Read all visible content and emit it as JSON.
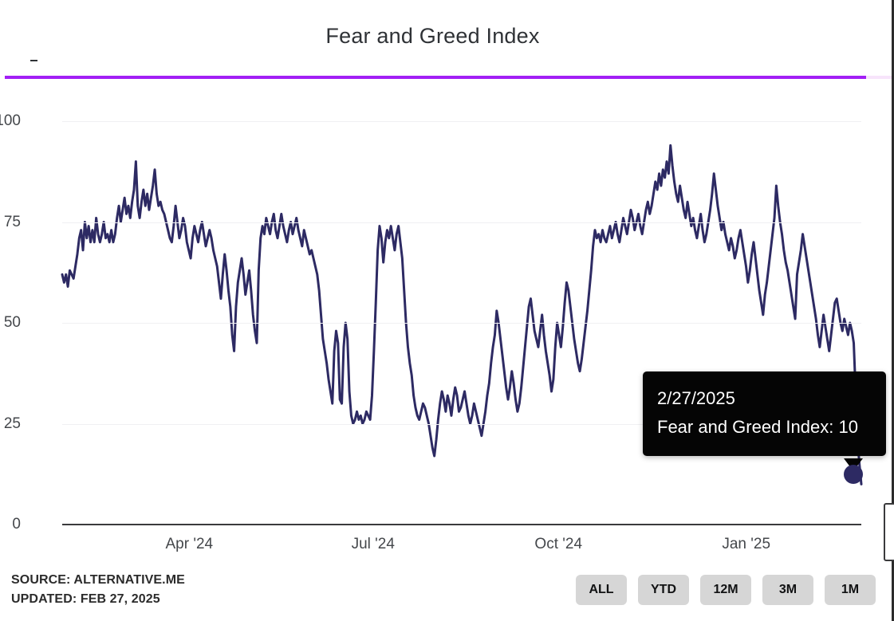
{
  "header": {
    "title": "Fear and Greed Index"
  },
  "progress": {
    "percent": 97,
    "fill_color": "#a21ff5",
    "track_color": "#f7e4fb"
  },
  "tooltip": {
    "date": "2/27/2025",
    "value_line": "Fear and Greed Index: 10",
    "background": "#050505",
    "text_color": "#ffffff"
  },
  "marker": {
    "color": "#2d2a63",
    "value": 10,
    "date": "2/27/2025"
  },
  "footer": {
    "source": "SOURCE: ALTERNATIVE.ME",
    "updated": "UPDATED: FEB 27, 2025"
  },
  "range_buttons": [
    {
      "label": "ALL",
      "selected": false
    },
    {
      "label": "YTD",
      "selected": false
    },
    {
      "label": "12M",
      "selected": false
    },
    {
      "label": "3M",
      "selected": false
    },
    {
      "label": "1M",
      "selected": false
    }
  ],
  "chart_data": {
    "type": "line",
    "title": "Fear and Greed Index",
    "xlabel": "",
    "ylabel": "",
    "ylim": [
      0,
      100
    ],
    "yticks": [
      0,
      25,
      50,
      75,
      100
    ],
    "xticks": [
      "Apr '24",
      "Jul '24",
      "Oct '24",
      "Jan '25"
    ],
    "xtick_positions": [
      0.159,
      0.389,
      0.621,
      0.856
    ],
    "grid": true,
    "legend": false,
    "line_color": "#2d2a63",
    "line_width": 3,
    "x_start": "2024-03-01",
    "x_end": "2025-02-27",
    "series": [
      {
        "name": "Fear and Greed Index",
        "values": [
          62,
          60,
          62,
          59,
          63,
          62,
          61,
          64,
          67,
          71,
          73,
          68,
          75,
          71,
          74,
          70,
          73,
          70,
          76,
          72,
          70,
          72,
          75,
          71,
          72,
          70,
          73,
          70,
          72,
          76,
          79,
          75,
          78,
          81,
          77,
          79,
          76,
          80,
          83,
          90,
          79,
          76,
          80,
          83,
          79,
          82,
          78,
          81,
          84,
          88,
          82,
          79,
          80,
          78,
          77,
          75,
          73,
          71,
          70,
          74,
          79,
          75,
          71,
          73,
          76,
          74,
          70,
          68,
          66,
          71,
          74,
          72,
          70,
          73,
          75,
          72,
          69,
          71,
          73,
          71,
          68,
          66,
          64,
          60,
          56,
          62,
          67,
          63,
          58,
          54,
          47,
          43,
          54,
          60,
          63,
          66,
          62,
          57,
          60,
          63,
          58,
          52,
          48,
          45,
          63,
          71,
          74,
          72,
          76,
          74,
          72,
          75,
          77,
          73,
          71,
          74,
          77,
          74,
          72,
          70,
          73,
          75,
          72,
          74,
          76,
          73,
          71,
          69,
          73,
          71,
          69,
          67,
          68,
          66,
          64,
          62,
          58,
          52,
          46,
          43,
          40,
          36,
          33,
          30,
          43,
          48,
          45,
          31,
          30,
          44,
          50,
          46,
          33,
          27,
          25,
          26,
          28,
          26,
          27,
          25,
          26,
          28,
          27,
          26,
          32,
          43,
          55,
          68,
          74,
          71,
          65,
          70,
          73,
          71,
          74,
          71,
          68,
          72,
          74,
          70,
          66,
          58,
          50,
          44,
          40,
          37,
          32,
          29,
          27,
          26,
          28,
          30,
          29,
          27,
          25,
          22,
          19,
          17,
          21,
          26,
          30,
          33,
          31,
          28,
          32,
          30,
          27,
          31,
          34,
          32,
          28,
          29,
          31,
          33,
          30,
          27,
          25,
          27,
          30,
          28,
          26,
          24,
          22,
          25,
          28,
          32,
          35,
          40,
          44,
          47,
          53,
          50,
          46,
          42,
          38,
          34,
          31,
          34,
          38,
          35,
          31,
          28,
          30,
          34,
          39,
          44,
          49,
          54,
          56,
          52,
          48,
          46,
          44,
          48,
          52,
          47,
          43,
          40,
          37,
          33,
          36,
          44,
          50,
          47,
          44,
          49,
          55,
          60,
          58,
          54,
          50,
          46,
          43,
          40,
          38,
          41,
          45,
          49,
          53,
          58,
          63,
          69,
          73,
          71,
          72,
          70,
          73,
          71,
          70,
          72,
          74,
          71,
          73,
          75,
          72,
          70,
          73,
          76,
          74,
          72,
          75,
          78,
          76,
          73,
          75,
          77,
          74,
          72,
          75,
          78,
          80,
          77,
          79,
          82,
          85,
          83,
          87,
          84,
          88,
          86,
          90,
          87,
          94,
          89,
          85,
          82,
          80,
          84,
          81,
          78,
          76,
          80,
          77,
          74,
          76,
          73,
          71,
          74,
          77,
          73,
          70,
          72,
          75,
          78,
          82,
          87,
          83,
          79,
          76,
          73,
          75,
          72,
          70,
          68,
          71,
          69,
          66,
          68,
          71,
          73,
          70,
          67,
          64,
          60,
          63,
          67,
          70,
          66,
          62,
          58,
          55,
          52,
          57,
          60,
          64,
          68,
          72,
          76,
          84,
          79,
          75,
          72,
          68,
          65,
          63,
          60,
          57,
          54,
          51,
          62,
          65,
          68,
          72,
          69,
          66,
          63,
          60,
          57,
          54,
          51,
          47,
          44,
          48,
          52,
          49,
          46,
          43,
          47,
          51,
          55,
          56,
          53,
          50,
          48,
          51,
          49,
          47,
          50,
          48,
          45,
          33,
          21,
          15,
          10
        ]
      }
    ],
    "annotations": [
      {
        "date": "2/27/2025",
        "value": 10,
        "label": "Fear and Greed Index: 10"
      }
    ],
    "source": "alternative.me",
    "updated": "Feb 27, 2025"
  }
}
